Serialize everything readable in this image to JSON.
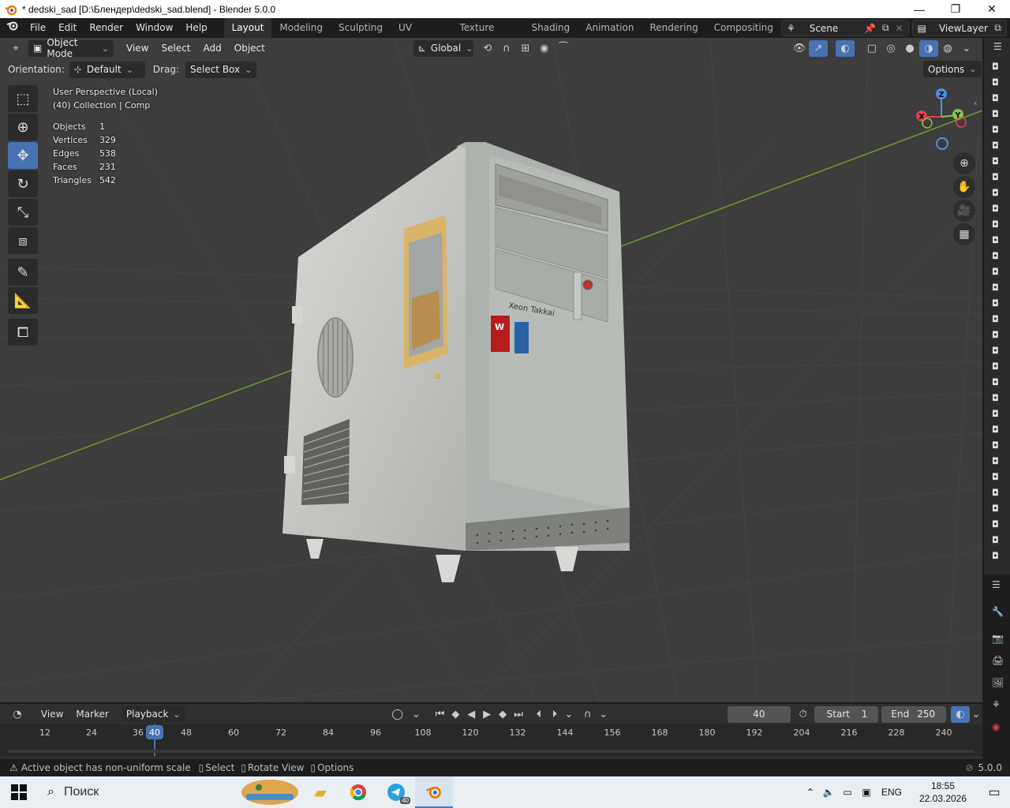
{
  "window": {
    "title": "* dedski_sad [D:\\Блендер\\dedski_sad.blend] - Blender 5.0.0",
    "controls": [
      "—",
      "❐",
      "✕"
    ]
  },
  "menubar": {
    "menus": [
      "File",
      "Edit",
      "Render",
      "Window",
      "Help"
    ],
    "workspaces": [
      "Layout",
      "Modeling",
      "Sculpting",
      "UV Editing",
      "Texture Paint",
      "Shading",
      "Animation",
      "Rendering",
      "Compositing"
    ],
    "active_workspace": "Layout",
    "scene": "Scene",
    "view_layer": "ViewLayer"
  },
  "viewport": {
    "mode": "Object Mode",
    "menus": [
      "View",
      "Select",
      "Add",
      "Object"
    ],
    "transform_orientation": "Global",
    "orientation_label": "Orientation:",
    "orientation_value": "Default",
    "drag_label": "Drag:",
    "drag_value": "Select Box",
    "options_label": "Options",
    "overlay_title": "User Perspective (Local)",
    "overlay_collection": "(40) Collection | Comp",
    "stats": [
      {
        "label": "Objects",
        "value": "1"
      },
      {
        "label": "Vertices",
        "value": "329"
      },
      {
        "label": "Edges",
        "value": "538"
      },
      {
        "label": "Faces",
        "value": "231"
      },
      {
        "label": "Triangles",
        "value": "542"
      }
    ],
    "gizmo_axes": {
      "x": "X",
      "y": "Y",
      "z": "Z"
    },
    "case_label": "Xeon Takkai"
  },
  "timeline": {
    "menus": [
      "View",
      "Marker"
    ],
    "playback": "Playback",
    "current_frame": "40",
    "start_label": "Start",
    "start_value": "1",
    "end_label": "End",
    "end_value": "250",
    "ruler_labels": [
      "12",
      "24",
      "36",
      "40",
      "48",
      "60",
      "72",
      "84",
      "96",
      "108",
      "120",
      "132",
      "144",
      "156",
      "168",
      "180",
      "192",
      "204",
      "216",
      "228",
      "240"
    ]
  },
  "statusbar": {
    "warning": "Active object has non-uniform scale",
    "select": "Select",
    "rotate_view": "Rotate View",
    "options": "Options",
    "version": "5.0.0"
  },
  "taskbar": {
    "search_placeholder": "Поиск",
    "lang": "ENG",
    "time": "18:55",
    "date": "22.03.2026",
    "telegram_badge": "40"
  },
  "colors": {
    "accent": "#4772b3",
    "viewport_bg": "#3d3d3d",
    "grid_line": "#4a4a4a",
    "x_axis": "#e04050",
    "y_axis": "#8bc34a",
    "z_axis": "#4f8fe6"
  }
}
